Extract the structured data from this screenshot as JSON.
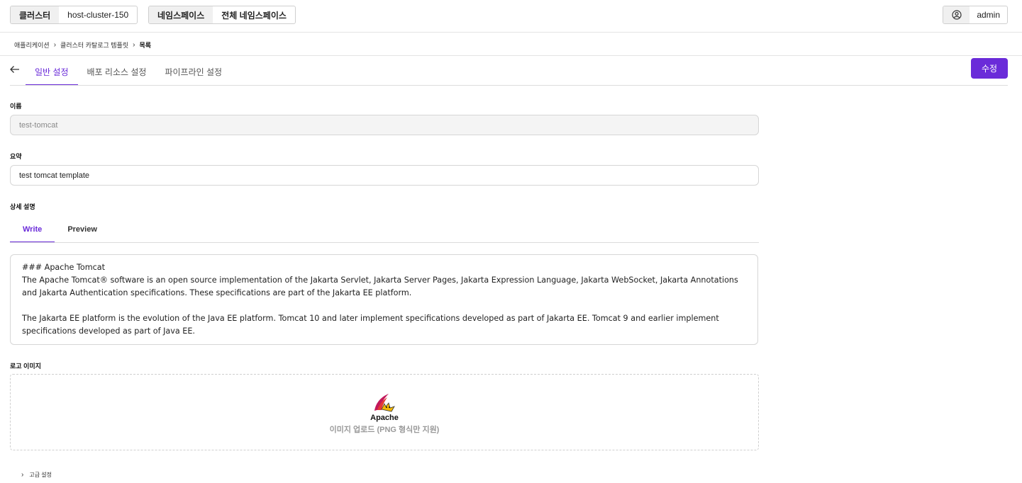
{
  "topbar": {
    "cluster_label": "클러스터",
    "cluster_value": "host-cluster-150",
    "namespace_label": "네임스페이스",
    "namespace_value": "전체 네임스페이스",
    "user_name": "admin",
    "user_icon": "user-circle-icon"
  },
  "breadcrumb": {
    "items": [
      "애플리케이션",
      "클러스터 카탈로그 템플릿",
      "목록"
    ],
    "separator": "›"
  },
  "tabs": {
    "back_icon": "arrow-left-icon",
    "items": [
      {
        "label": "일반 설정",
        "active": true
      },
      {
        "label": "배포 리소스 설정",
        "active": false
      },
      {
        "label": "파이프라인 설정",
        "active": false
      }
    ],
    "edit_label": "수정"
  },
  "form": {
    "name_label": "이름",
    "name_value": "test-tomcat",
    "summary_label": "요약",
    "summary_value": "test tomcat template",
    "detail_label": "상세 설명",
    "detail_tabs": [
      {
        "label": "Write",
        "active": true
      },
      {
        "label": "Preview",
        "active": false
      }
    ],
    "detail_value": "### Apache Tomcat\nThe Apache Tomcat® software is an open source implementation of the Jakarta Servlet, Jakarta Server Pages, Jakarta Expression Language, Jakarta WebSocket, Jakarta Annotations and Jakarta Authentication specifications. These specifications are part of the Jakarta EE platform.\n\nThe Jakarta EE platform is the evolution of the Java EE platform. Tomcat 10 and later implement specifications developed as part of Jakarta EE. Tomcat 9 and earlier implement specifications developed as part of Java EE.",
    "logo_label": "로고 이미지",
    "logo_text": "Apache",
    "upload_text": "이미지 업로드 (PNG 형식만 지원)",
    "advanced_label": "고급 설정"
  },
  "colors": {
    "accent": "#6a2bd9"
  }
}
